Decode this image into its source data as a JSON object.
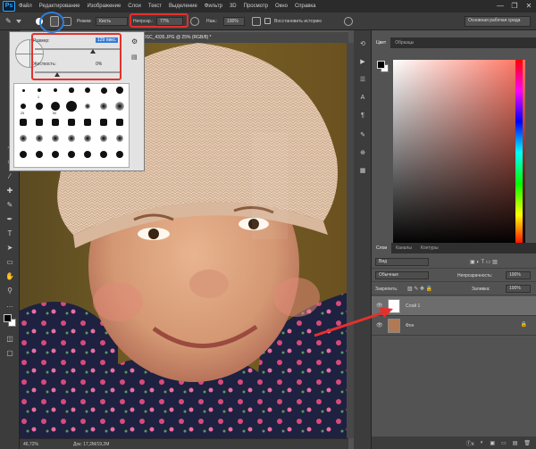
{
  "app": {
    "logo": "Ps"
  },
  "menu": [
    "Файл",
    "Редактирование",
    "Изображение",
    "Слои",
    "Текст",
    "Выделение",
    "Фильтр",
    "3D",
    "Просмотр",
    "Окно",
    "Справка"
  ],
  "window_controls": [
    "—",
    "❐",
    "✕"
  ],
  "options": {
    "mode_label": "Режим:",
    "mode_value": "Кисть",
    "opacity_label": "Непрозр.:",
    "opacity_value": "77%",
    "pressure_label": "Наж.:",
    "pressure_value": "100%",
    "restore_history": "Восстановить историю",
    "workspace": "Основная рабочая среда"
  },
  "document": {
    "tab_title": "DSC_4335.JPG @ 25% (RGB/8) *",
    "zoom": "46,72%",
    "doc_info": "Док: 17,2М/19,2М"
  },
  "brush_panel": {
    "size_label": "Размер:",
    "size_value": "129 пикс.",
    "hardness_label": "Жесткость:",
    "hardness_value": "0%",
    "preset_labels": [
      "",
      "1",
      "",
      "",
      "",
      "",
      "",
      "25",
      "",
      "50",
      "",
      "",
      "",
      "",
      "",
      "",
      "",
      "",
      "",
      "",
      "",
      "",
      "",
      "",
      "",
      "",
      "",
      "",
      "",
      "",
      "",
      "",
      "",
      "",
      "",
      "",
      "",
      "",
      "",
      "",
      "30",
      "",
      "",
      "",
      "",
      "",
      "",
      "",
      "",
      "",
      "",
      "",
      "",
      "",
      "",
      "",
      "",
      "",
      "",
      "",
      "",
      ""
    ]
  },
  "color_panel": {
    "tabs": [
      "Цвет",
      "Образцы"
    ],
    "hue_accent": "#ff6f5c"
  },
  "layers_panel": {
    "tabs": [
      "Слои",
      "Каналы",
      "Контуры"
    ],
    "kind_label": "Вид",
    "blend_mode": "Обычные",
    "opacity_label": "Непрозрачность:",
    "opacity_value": "100%",
    "lock_label": "Закрепить:",
    "fill_label": "Заливка:",
    "fill_value": "100%",
    "layers": [
      {
        "name": "Слой 1"
      },
      {
        "name": "Фон"
      }
    ],
    "footer_icons": [
      "ⓕx",
      "◐",
      "▣",
      "▭",
      "▤",
      "🗑"
    ]
  },
  "annotations": {
    "highlight_color": "#e3312d",
    "ring_color": "#2f7cd8"
  }
}
